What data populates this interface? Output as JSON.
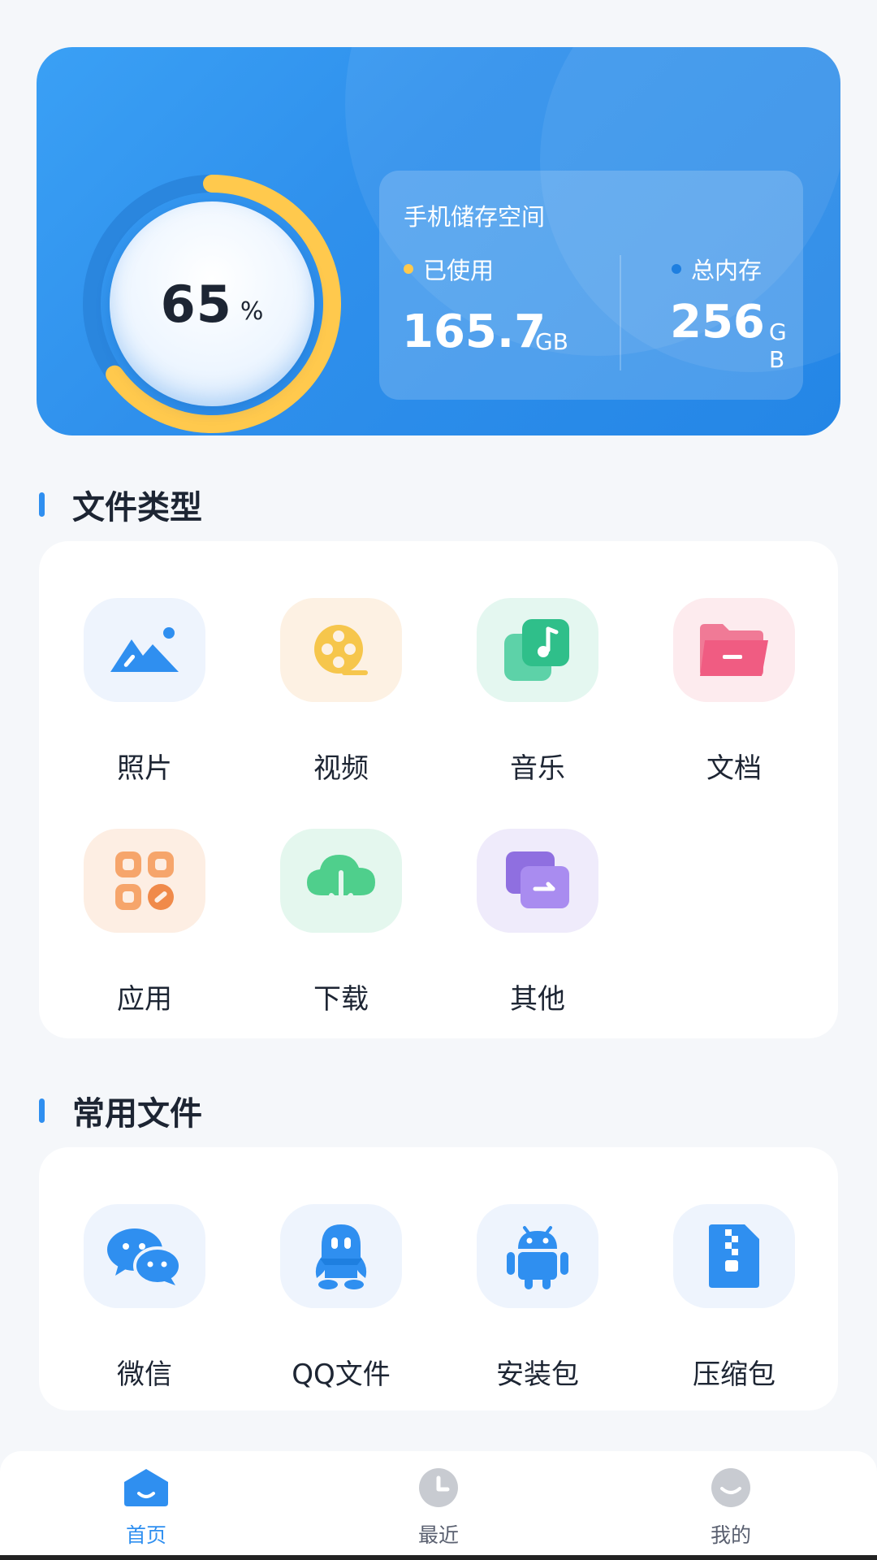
{
  "storage": {
    "percent": "65",
    "percent_sign": "%",
    "percent_value": 0.65,
    "title": "手机储存空间",
    "used_label": "已使用",
    "used_value": "165.7",
    "used_unit": "GB",
    "total_label": "总内存",
    "total_value": "256",
    "total_unit_1": "G",
    "total_unit_2": "B",
    "colors": {
      "used": "#ffc94d",
      "total": "#1e7fe0",
      "ring": "#ffc94d"
    }
  },
  "file_types": {
    "title": "文件类型",
    "items": [
      {
        "label": "照片",
        "icon": "photo-icon"
      },
      {
        "label": "视频",
        "icon": "video-reel-icon"
      },
      {
        "label": "音乐",
        "icon": "music-icon"
      },
      {
        "label": "文档",
        "icon": "folder-icon"
      },
      {
        "label": "应用",
        "icon": "apps-icon"
      },
      {
        "label": "下载",
        "icon": "download-cloud-icon"
      },
      {
        "label": "其他",
        "icon": "other-files-icon"
      }
    ]
  },
  "common_files": {
    "title": "常用文件",
    "items": [
      {
        "label": "微信",
        "icon": "wechat-icon"
      },
      {
        "label": "QQ文件",
        "icon": "qq-icon"
      },
      {
        "label": "安装包",
        "icon": "android-icon"
      },
      {
        "label": "压缩包",
        "icon": "zip-icon"
      }
    ]
  },
  "tabbar": {
    "items": [
      {
        "label": "首页",
        "icon": "home-icon",
        "active": true
      },
      {
        "label": "最近",
        "icon": "clock-icon",
        "active": false
      },
      {
        "label": "我的",
        "icon": "profile-icon",
        "active": false
      }
    ]
  }
}
